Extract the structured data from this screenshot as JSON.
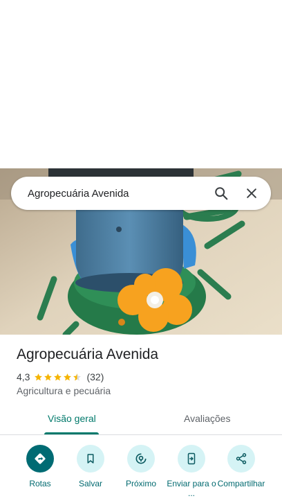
{
  "search": {
    "query": "Agropecuária Avenida"
  },
  "place": {
    "name": "Agropecuária Avenida",
    "rating": "4,3",
    "rating_value": 4.3,
    "reviews_count": "(32)",
    "category": "Agricultura e pecuária"
  },
  "tabs": [
    {
      "label": "Visão geral",
      "active": true
    },
    {
      "label": "Avaliações",
      "active": false
    }
  ],
  "actions": [
    {
      "label": "Rotas",
      "icon": "directions-icon"
    },
    {
      "label": "Salvar",
      "icon": "bookmark-icon"
    },
    {
      "label": "Próximo",
      "icon": "nearby-icon"
    },
    {
      "label": "Enviar para o ...",
      "icon": "send-to-phone-icon"
    },
    {
      "label": "Compartilhar",
      "icon": "share-icon"
    }
  ],
  "colors": {
    "accent": "#00796b",
    "star": "#f5b400",
    "action_bg": "#d5f3f5",
    "action_primary": "#006b73"
  }
}
